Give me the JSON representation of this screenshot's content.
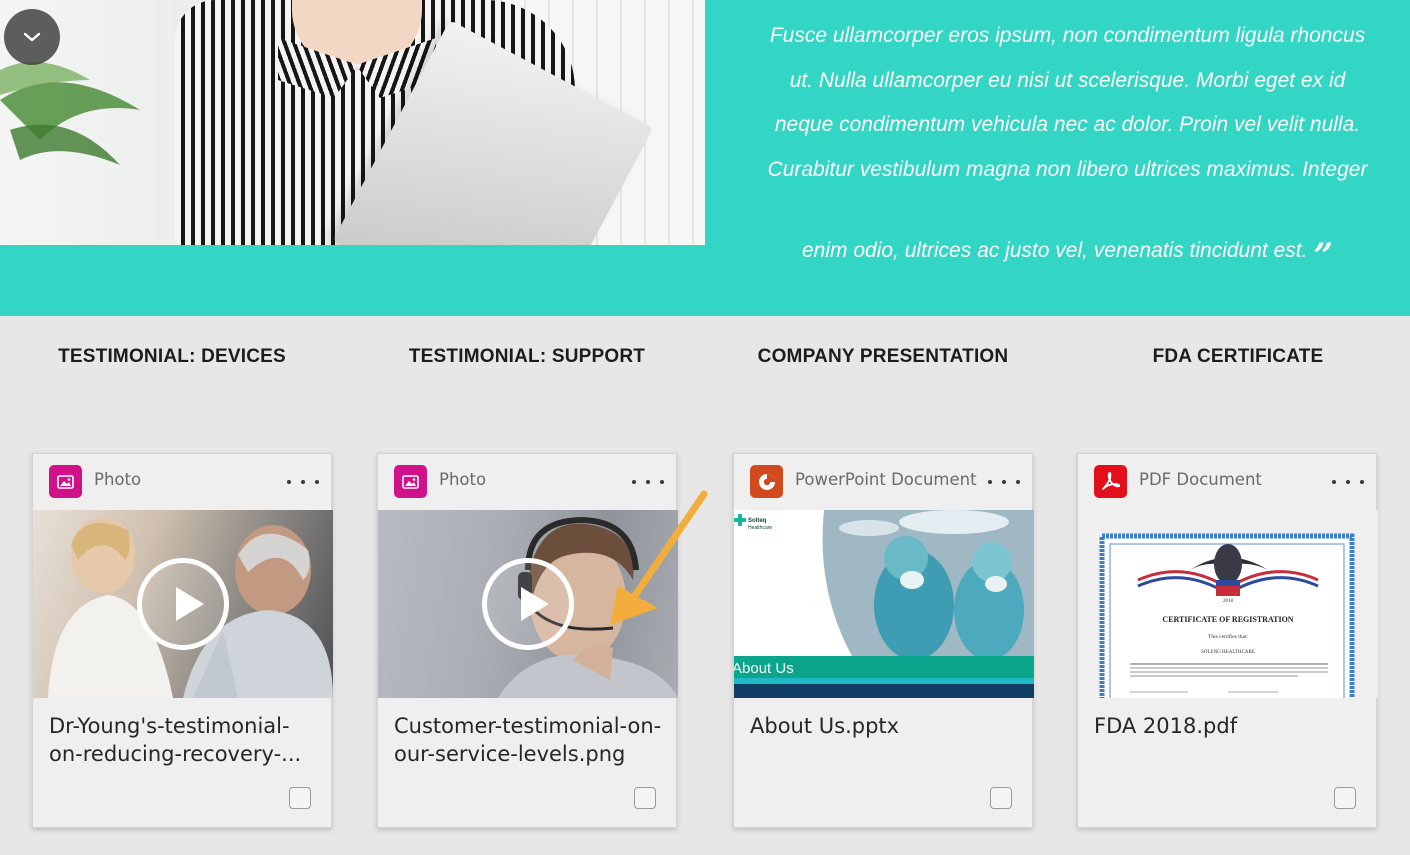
{
  "hero": {
    "quote_lines": [
      "Fusce ullamcorper eros ipsum, non condimentum ligula rhoncus",
      "ut. Nulla ullamcorper eu nisi ut scelerisque. Morbi eget ex id",
      "neque condimentum vehicula nec ac dolor. Proin vel velit nulla.",
      "Curabitur vestibulum magna non libero ultrices maximus. Integer"
    ],
    "quote_last_line": "enim odio, ultrices ac justo vel, venenatis tincidunt est.",
    "quote_close_mark": "”",
    "background_color": "#33d6c5"
  },
  "columns": [
    {
      "heading": "TESTIMONIAL: DEVICES",
      "type_label": "Photo",
      "type_icon": "image-icon",
      "icon_color": "#d0118a",
      "title": "Dr-Young's-testimonial-on-reducing-recovery-..."
    },
    {
      "heading": "TESTIMONIAL: SUPPORT",
      "type_label": "Photo",
      "type_icon": "image-icon",
      "icon_color": "#d0118a",
      "title": "Customer-testimonial-on-our-service-levels.png"
    },
    {
      "heading": "COMPANY PRESENTATION",
      "type_label": "PowerPoint Document",
      "type_icon": "powerpoint-icon",
      "icon_color": "#d04a1d",
      "title": "About Us.pptx",
      "thumb_text": {
        "logo": "Solteq Healthcare",
        "banner": "About Us"
      }
    },
    {
      "heading": "FDA CERTIFICATE",
      "type_label": "PDF Document",
      "type_icon": "pdf-icon",
      "icon_color": "#e3101c",
      "title": "FDA 2018.pdf",
      "thumb_text": {
        "year": "2018",
        "cert_title": "CERTIFICATE OF REGISTRATION",
        "certifies": "This certifies that:",
        "company": "SOLENG HEALTHCARE"
      }
    }
  ]
}
